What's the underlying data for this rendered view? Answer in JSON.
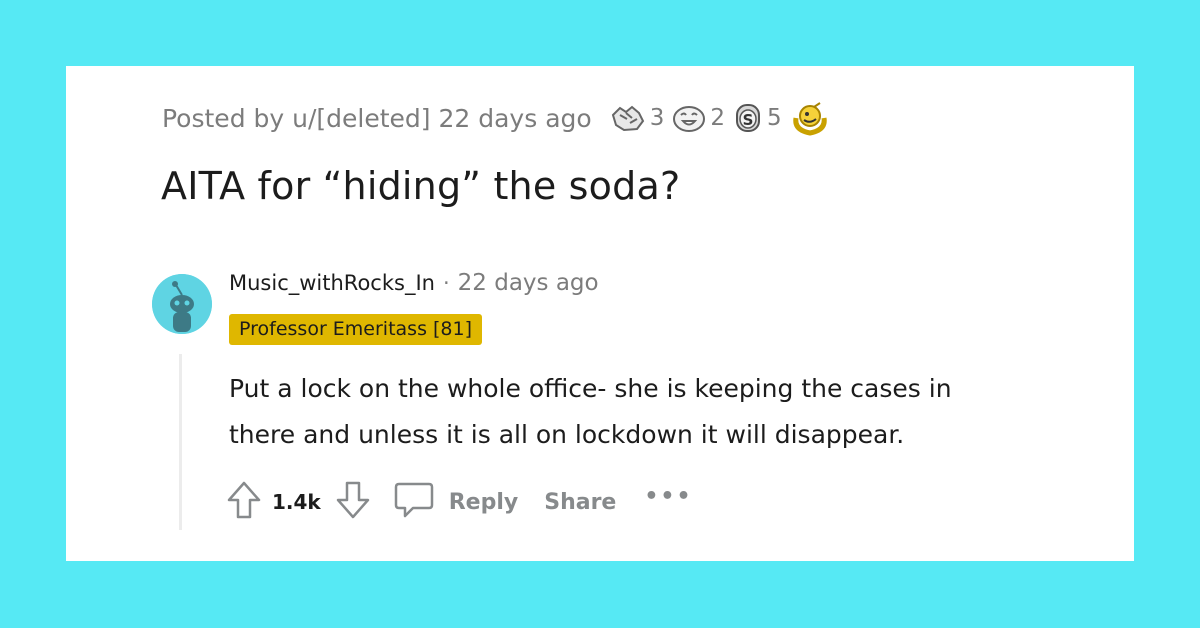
{
  "colors": {
    "background": "#56e9f4",
    "card": "#ffffff",
    "flair_bg": "#dfb700",
    "avatar_bg": "#5fd4e3",
    "muted_text": "#7c7c7c"
  },
  "post": {
    "posted_by": "Posted by u/[deleted]",
    "time": "22 days ago",
    "awards": [
      {
        "icon": "fist-bump-award-icon",
        "count": "3"
      },
      {
        "icon": "laughing-face-award-icon",
        "count": "2"
      },
      {
        "icon": "silver-coin-award-icon",
        "count": "5"
      },
      {
        "icon": "gold-wreath-award-icon",
        "count": ""
      }
    ],
    "title": "AITA for “hiding” the soda?"
  },
  "comment": {
    "avatar_icon": "snoo-avatar-icon",
    "author": "Music_withRocks_In",
    "separator": "·",
    "time": "22 days ago",
    "flair": "Professor Emeritass [81]",
    "body_lines": [
      "Put a lock on the whole office- she is keeping the cases in",
      "there and unless it is all on lockdown it will disappear."
    ],
    "score": "1.4k",
    "reply_label": "Reply",
    "share_label": "Share",
    "more_label": "•••"
  }
}
